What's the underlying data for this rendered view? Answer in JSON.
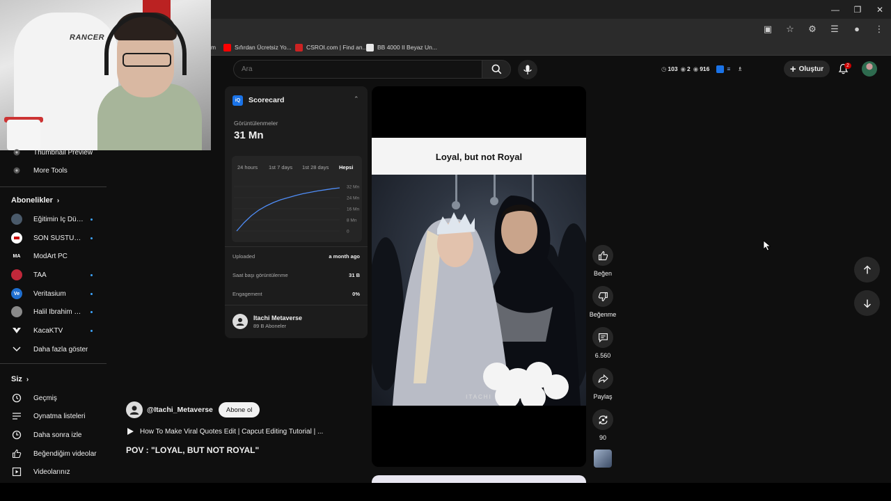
{
  "bookmarks": [
    {
      "label": "m",
      "color": "#2b2b2b"
    },
    {
      "label": "Sıfırdan Ücretsiz Yo...",
      "color": "#ff0000"
    },
    {
      "label": "CSROI.com | Find an...",
      "color": "#cc2222"
    },
    {
      "label": "BB 4000 II Beyaz Un...",
      "color": "#e8e8e8"
    }
  ],
  "sidebar": {
    "tools": [
      {
        "label": "Thumbnail Preview",
        "icon": "tool-icon"
      },
      {
        "label": "More Tools",
        "icon": "tool-icon"
      }
    ],
    "subscriptions_title": "Abonelikler",
    "subscriptions": [
      {
        "label": "Eğitimin İç Düny...",
        "avatar_color": "#4a5a6a",
        "avatar_text": ""
      },
      {
        "label": "SON SUSTURUCU",
        "avatar_color": "#ffffff",
        "avatar_text": ""
      },
      {
        "label": "ModArt PC",
        "avatar_color": "#0f0f0f",
        "avatar_text": "MA"
      },
      {
        "label": "TAA",
        "avatar_color": "#c0283a",
        "avatar_text": ""
      },
      {
        "label": "Veritasium",
        "avatar_color": "#1f6fd0",
        "avatar_text": "Ve"
      },
      {
        "label": "Halil İbrahim Gök...",
        "avatar_color": "#8a8a8a",
        "avatar_text": ""
      },
      {
        "label": "KacaKTV",
        "avatar_color": "#0f0f0f",
        "avatar_text": ""
      }
    ],
    "show_more": "Daha fazla göster",
    "you_title": "Siz",
    "you_items": [
      {
        "label": "Geçmiş",
        "icon": "history-icon"
      },
      {
        "label": "Oynatma listeleri",
        "icon": "playlists-icon"
      },
      {
        "label": "Daha sonra izle",
        "icon": "watch-later-icon"
      },
      {
        "label": "Beğendiğim videolar",
        "icon": "liked-videos-icon"
      },
      {
        "label": "Videolarınız",
        "icon": "your-videos-icon"
      }
    ]
  },
  "search": {
    "placeholder": "Ara"
  },
  "header_stats": {
    "a": "103",
    "b": "2",
    "c": "916"
  },
  "header": {
    "create_label": "Oluştur",
    "notification_count": "2"
  },
  "scorecard": {
    "title": "Scorecard",
    "logo_text": "iQ",
    "views_label": "Görüntülenmeler",
    "views_value": "31 Mn",
    "tabs": [
      "24 hours",
      "1st 7 days",
      "1st 28 days",
      "Hepsi"
    ],
    "active_tab": 3,
    "rows": [
      {
        "label": "Uploaded",
        "value": "a month ago"
      },
      {
        "label": "Saat başı görüntülenme",
        "value": "31 B"
      },
      {
        "label": "Engagement",
        "value": "0%"
      }
    ],
    "channel_name": "Itachi Metaverse",
    "channel_subs": "89 B Aboneler"
  },
  "chart_data": {
    "type": "line",
    "yticks": [
      "32 Mn",
      "24 Mn",
      "16 Mn",
      "8 Mn",
      "0"
    ],
    "ylim": [
      0,
      32
    ],
    "series": [
      {
        "values": [
          0,
          6,
          11,
          15,
          18,
          20.5,
          22.5,
          24,
          25.5,
          26.8,
          27.8,
          28.8,
          29.6,
          30.4,
          31
        ]
      }
    ],
    "color": "#4f8df7"
  },
  "video": {
    "caption": "Loyal, but not Royal",
    "watermark": "ITACHI",
    "channel_handle": "@Itachi_Metaverse",
    "subscribe_label": "Abone ol",
    "playlist_title": "How To Make Viral Quotes Edit | Capcut Editing Tutorial | ...",
    "title": "POV : \"LOYAL, BUT NOT ROYAL\""
  },
  "actions": [
    {
      "label": "Beğen",
      "icon": "like-icon"
    },
    {
      "label": "Beğenme",
      "icon": "dislike-icon"
    },
    {
      "label": "6.560",
      "icon": "comment-icon"
    },
    {
      "label": "Paylaş",
      "icon": "share-icon"
    },
    {
      "label": "90",
      "icon": "remix-icon"
    }
  ]
}
